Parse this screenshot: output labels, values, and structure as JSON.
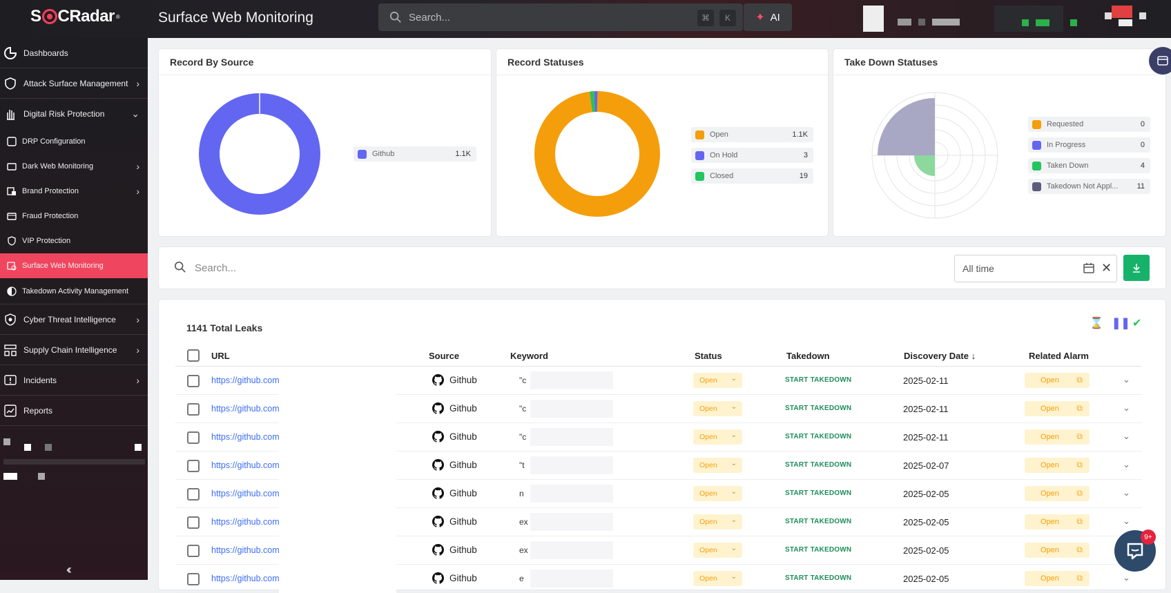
{
  "app": {
    "brand": "SOCRadar",
    "title": "Surface Web Monitoring"
  },
  "topbar": {
    "search_placeholder": "Search...",
    "kbd_cmd": "⌘",
    "kbd_k": "K",
    "ai_label": "AI"
  },
  "sidebar": {
    "items": [
      {
        "label": "Dashboards",
        "icon": "dashboard-icon"
      },
      {
        "label": "Attack Surface Management",
        "icon": "shield-icon"
      },
      {
        "label": "Digital Risk Protection",
        "icon": "hand-icon"
      },
      {
        "label": "DRP Configuration",
        "icon": "config-icon"
      },
      {
        "label": "Dark Web Monitoring",
        "icon": "darkweb-icon"
      },
      {
        "label": "Brand Protection",
        "icon": "brand-icon"
      },
      {
        "label": "Fraud Protection",
        "icon": "fraud-icon"
      },
      {
        "label": "VIP Protection",
        "icon": "vip-icon"
      },
      {
        "label": "Surface Web Monitoring",
        "icon": "surface-web-icon"
      },
      {
        "label": "Takedown Activity Management",
        "icon": "takedown-icon"
      },
      {
        "label": "Cyber Threat Intelligence",
        "icon": "eye-icon"
      },
      {
        "label": "Supply Chain Intelligence",
        "icon": "supply-chain-icon"
      },
      {
        "label": "Incidents",
        "icon": "incident-icon"
      },
      {
        "label": "Reports",
        "icon": "reports-icon"
      }
    ]
  },
  "colors": {
    "accent": "#f0455f",
    "github": "#6366f1",
    "open": "#f59e0b",
    "on_hold": "#6366f1",
    "closed": "#22c55e",
    "requested": "#f59e0b",
    "in_progress": "#6366f1",
    "taken_down": "#22c55e",
    "takedown_na": "#5b5b7e"
  },
  "cards": {
    "record_by_source": {
      "title": "Record By Source",
      "legend": [
        {
          "label": "Github",
          "value": "1.1K"
        }
      ]
    },
    "record_statuses": {
      "title": "Record Statuses",
      "legend": [
        {
          "label": "Open",
          "value": "1.1K"
        },
        {
          "label": "On Hold",
          "value": "3"
        },
        {
          "label": "Closed",
          "value": "19"
        }
      ]
    },
    "take_down_statuses": {
      "title": "Take Down Statuses",
      "legend": [
        {
          "label": "Requested",
          "value": "0"
        },
        {
          "label": "In Progress",
          "value": "0"
        },
        {
          "label": "Taken Down",
          "value": "4"
        },
        {
          "label": "Takedown Not Appl...",
          "value": "11"
        }
      ]
    }
  },
  "filter": {
    "search_placeholder": "Search...",
    "date_range": "All time"
  },
  "table": {
    "total": "1141 Total Leaks",
    "headers": {
      "url": "URL",
      "source": "Source",
      "keyword": "Keyword",
      "status": "Status",
      "takedown": "Takedown",
      "discovery": "Discovery Date",
      "alarm": "Related Alarm"
    },
    "rows": [
      {
        "url": "https://github.com",
        "source": "Github",
        "keyword": "\"c",
        "status": "Open",
        "takedown": "START TAKEDOWN",
        "date": "2025-02-11",
        "alarm": "Open"
      },
      {
        "url": "https://github.com",
        "source": "Github",
        "keyword": "\"c",
        "status": "Open",
        "takedown": "START TAKEDOWN",
        "date": "2025-02-11",
        "alarm": "Open"
      },
      {
        "url": "https://github.com",
        "source": "Github",
        "keyword": "\"c",
        "status": "Open",
        "takedown": "START TAKEDOWN",
        "date": "2025-02-11",
        "alarm": "Open"
      },
      {
        "url": "https://github.com",
        "source": "Github",
        "keyword": "\"t",
        "status": "Open",
        "takedown": "START TAKEDOWN",
        "date": "2025-02-07",
        "alarm": "Open"
      },
      {
        "url": "https://github.com",
        "source": "Github",
        "keyword": "n",
        "status": "Open",
        "takedown": "START TAKEDOWN",
        "date": "2025-02-05",
        "alarm": "Open"
      },
      {
        "url": "https://github.com",
        "source": "Github",
        "keyword": "ex",
        "status": "Open",
        "takedown": "START TAKEDOWN",
        "date": "2025-02-05",
        "alarm": "Open"
      },
      {
        "url": "https://github.com",
        "source": "Github",
        "keyword": "ex",
        "status": "Open",
        "takedown": "START TAKEDOWN",
        "date": "2025-02-05",
        "alarm": "Open"
      },
      {
        "url": "https://github.com",
        "source": "Github",
        "keyword": "e",
        "status": "Open",
        "takedown": "START TAKEDOWN",
        "date": "2025-02-05",
        "alarm": "Open"
      }
    ]
  },
  "support": {
    "badge": "9+"
  }
}
